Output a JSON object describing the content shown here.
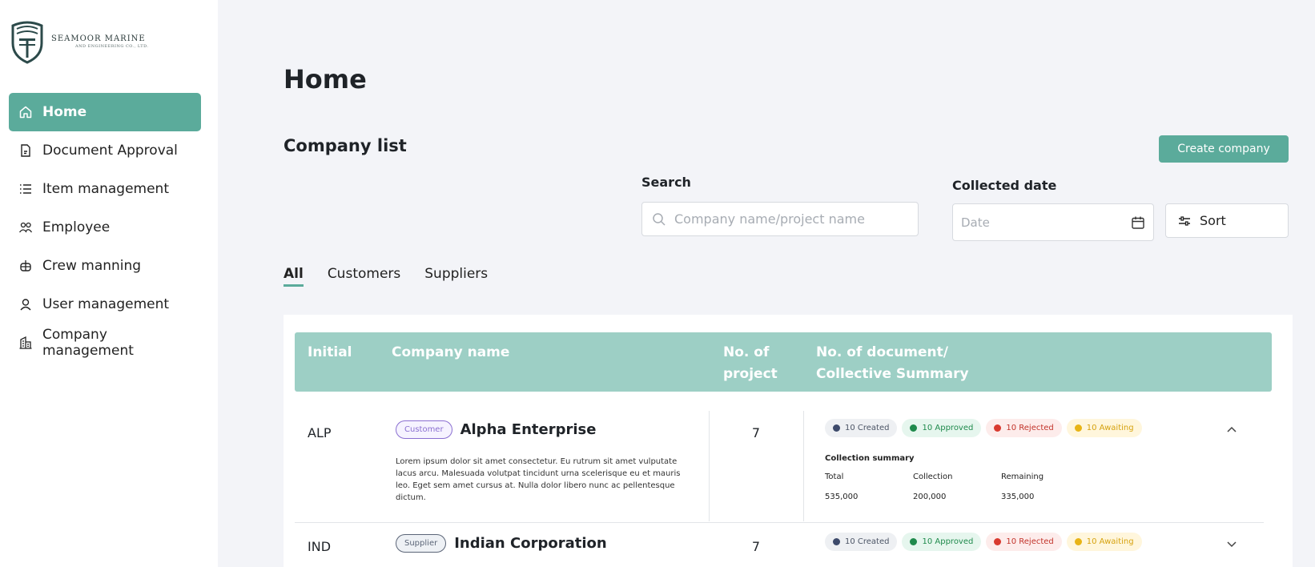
{
  "brand": {
    "name": "SEAMOOR MARINE",
    "sub": "AND ENGINEERING CO., LTD."
  },
  "sidebar": {
    "items": [
      {
        "label": "Home",
        "icon": "home-icon",
        "active": true
      },
      {
        "label": "Document Approval",
        "icon": "document-icon"
      },
      {
        "label": "Item management",
        "icon": "list-icon"
      },
      {
        "label": "Employee",
        "icon": "people-icon"
      },
      {
        "label": "Crew manning",
        "icon": "helm-icon"
      },
      {
        "label": "User management",
        "icon": "user-icon"
      },
      {
        "label": "Company management",
        "icon": "building-icon"
      }
    ]
  },
  "page": {
    "title": "Home",
    "section_title": "Company list",
    "create_button": "Create company"
  },
  "search": {
    "label": "Search",
    "placeholder": "Company name/project name",
    "value": ""
  },
  "date_filter": {
    "label": "Collected date",
    "placeholder": "Date"
  },
  "sort": {
    "label": "Sort"
  },
  "tabs": [
    {
      "label": "All",
      "active": true
    },
    {
      "label": "Customers"
    },
    {
      "label": "Suppliers"
    }
  ],
  "table": {
    "headers": {
      "initial": "Initial",
      "company_name": "Company name",
      "projects_line1": "No. of",
      "projects_line2": "project",
      "docs_line1": "No. of document/",
      "docs_line2": "Collective Summary"
    },
    "rows": [
      {
        "initial": "ALP",
        "type": "Customer",
        "name": "Alpha Enterprise",
        "description": "Lorem ipsum dolor sit amet consectetur. Eu rutrum sit amet vulputate lacus arcu. Malesuada volutpat tincidunt urna scelerisque eu et mauris leo. Eget sem amet cursus at. Nulla dolor libero nunc ac pellentesque dictum.",
        "projects": "7",
        "created": "10 Created",
        "approved": "10 Approved",
        "rejected": "10 Rejected",
        "awaiting": "10 Awaiting",
        "expanded": true,
        "summary": {
          "title": "Collection summary",
          "total_label": "Total",
          "collection_label": "Collection",
          "remaining_label": "Remaining",
          "total": "535,000",
          "collection": "200,000",
          "remaining": "335,000"
        }
      },
      {
        "initial": "IND",
        "type": "Supplier",
        "name": "Indian Corporation",
        "projects": "7",
        "created": "10 Created",
        "approved": "10 Approved",
        "rejected": "10 Rejected",
        "awaiting": "10 Awaiting",
        "expanded": false
      }
    ]
  },
  "colors": {
    "accent": "#5bab9b",
    "header": "#9dcfc5",
    "created": "#3d4a6b",
    "approved": "#1f8a4c",
    "rejected": "#d93a2f",
    "awaiting": "#e8b416"
  }
}
